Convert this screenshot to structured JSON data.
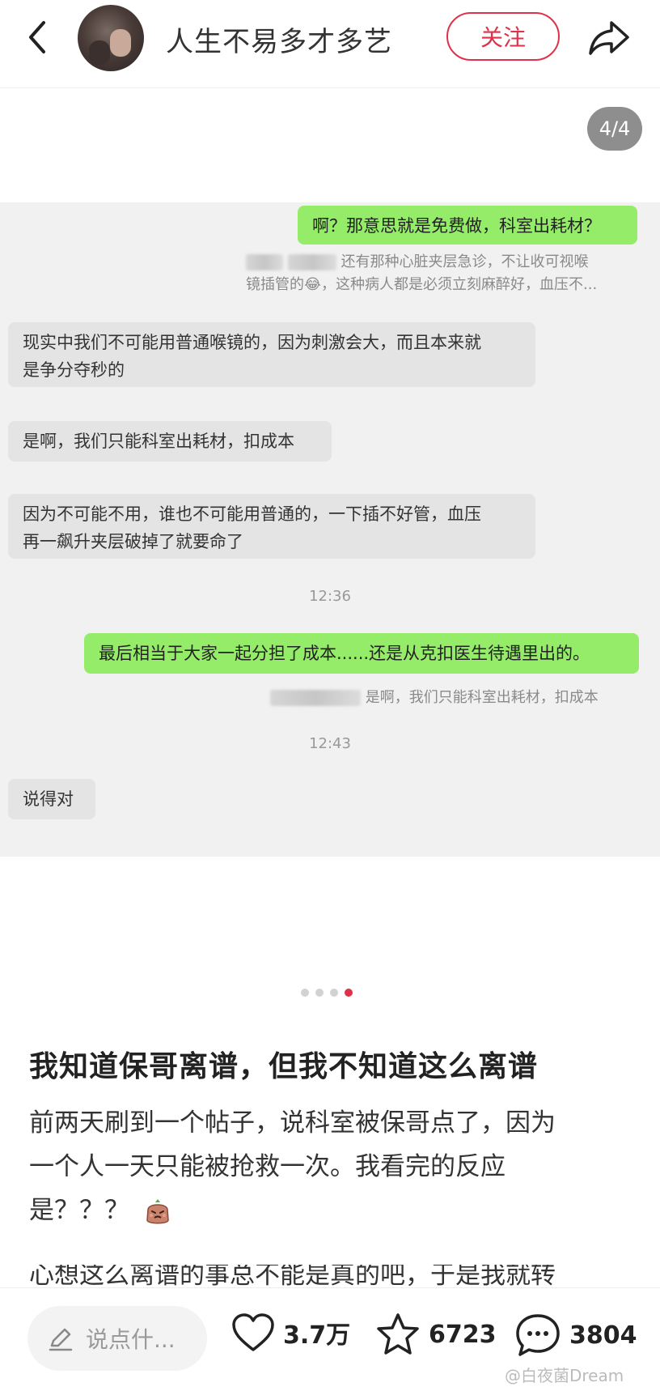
{
  "header": {
    "author_name": "人生不易多才多艺",
    "follow_label": "关注"
  },
  "gallery": {
    "counter": "4/4",
    "total": 4,
    "active_index": 4
  },
  "chat": {
    "messages": [
      {
        "side": "me",
        "text": "啊？那意思就是免费做，科室出耗材？"
      },
      {
        "side": "quote",
        "text1": "还有那种心脏夹层急诊，不让收可视喉",
        "text2": "镜插管的😂，这种病人都是必须立刻麻醉好，血压不..."
      },
      {
        "side": "other",
        "text1": "现实中我们不可能用普通喉镜的，因为刺激会大，而且本来就",
        "text2": "是争分夺秒的"
      },
      {
        "side": "other",
        "text1": "是啊，我们只能科室出耗材，扣成本"
      },
      {
        "side": "other",
        "text1": "因为不可能不用，谁也不可能用普通的，一下插不好管，血压",
        "text2": "再一飙升夹层破掉了就要命了"
      },
      {
        "side": "time",
        "text": "12:36"
      },
      {
        "side": "me",
        "text": "最后相当于大家一起分担了成本......还是从克扣医生待遇里出的。"
      },
      {
        "side": "quote",
        "text1": "是啊，我们只能科室出耗材，扣成本"
      },
      {
        "side": "time",
        "text": "12:43"
      },
      {
        "side": "other",
        "text1": "说得对"
      }
    ]
  },
  "post": {
    "title": "我知道保哥离谱，但我不知道这么离谱",
    "body_line1": "前两天刷到一个帖子，说科室被保哥点了，因为",
    "body_line2": "一个人一天只能被抢救一次。我看完的反应",
    "body_line3": "是？？？",
    "body_cut": "心想这么离谱的事总不能是真的吧，于是我就转"
  },
  "bottom_bar": {
    "comment_placeholder": "说点什...",
    "likes": "3.7万",
    "favorites": "6723",
    "comments": "3804",
    "watermark": "@白夜菌Dream"
  },
  "colors": {
    "accent": "#e0314a",
    "my_bubble": "#95ec69",
    "other_bubble": "#e4e4e4",
    "chat_bg": "#f1f1f1"
  },
  "icons": [
    "back-arrow-icon",
    "share-icon",
    "pencil-icon",
    "heart-icon",
    "star-icon",
    "comment-bubble-icon",
    "emoji-sticker-icon"
  ]
}
